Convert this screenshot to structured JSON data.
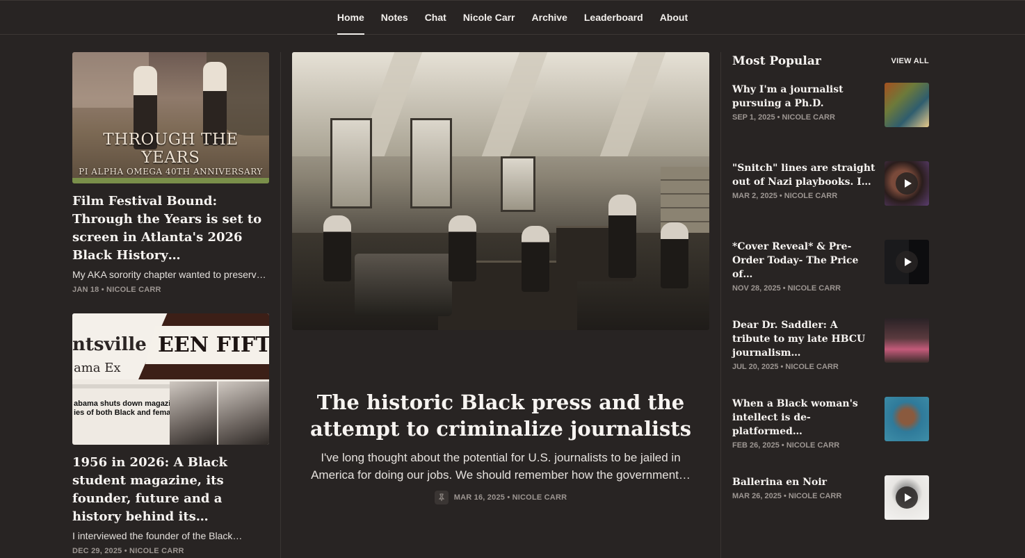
{
  "nav": {
    "items": [
      "Home",
      "Notes",
      "Chat",
      "Nicole Carr",
      "Archive",
      "Leaderboard",
      "About"
    ],
    "active": "Home"
  },
  "left": {
    "posts": [
      {
        "image_text_line1": "THROUGH THE YEARS",
        "image_text_line2": "PI ALPHA OMEGA 40TH ANNIVERSARY",
        "title": "Film Festival Bound: Through the Years is set to screen in Atlanta's 2026 Black History…",
        "subtitle": "My AKA sorority chapter wanted to preserv…",
        "meta": "JAN 18 • NICOLE CARR"
      },
      {
        "image_text_masthead": "EEN FIFTY-SIX",
        "image_text_tsville": "ntsville",
        "image_text_ama": "ama Ex",
        "image_text_headline": "abama shuts down magazines\nies of both Black and female",
        "title": "1956 in 2026: A Black student magazine, its founder, future and a history behind its…",
        "subtitle": "I interviewed the founder of the Black…",
        "meta": "DEC 29, 2025 • NICOLE CARR"
      }
    ]
  },
  "hero": {
    "title": "The historic Black press and the attempt to criminalize journalists",
    "subtitle": "I've long thought about the potential for U.S. journalists to be jailed in America for doing our jobs. We should remember how the government…",
    "meta": "MAR 16, 2025 • NICOLE CARR"
  },
  "popular": {
    "heading": "Most Popular",
    "view_all": "VIEW ALL",
    "items": [
      {
        "title": "Why I'm a journalist pursuing a Ph.D.",
        "meta": "SEP 1, 2025 • NICOLE CARR",
        "video": false
      },
      {
        "title": "\"Snitch\" lines are straight out of Nazi playbooks. I…",
        "meta": "MAR 2, 2025 • NICOLE CARR",
        "video": true
      },
      {
        "title": "*Cover Reveal* & Pre-Order Today- The Price of…",
        "meta": "NOV 28, 2025 • NICOLE CARR",
        "video": true
      },
      {
        "title": "Dear Dr. Saddler: A tribute to my late HBCU journalism…",
        "meta": "JUL 20, 2025 • NICOLE CARR",
        "video": false
      },
      {
        "title": "When a Black woman's intellect is de-platformed…",
        "meta": "FEB 26, 2025 • NICOLE CARR",
        "video": false
      },
      {
        "title": "Ballerina en Noir",
        "meta": "MAR 26, 2025 • NICOLE CARR",
        "video": true
      }
    ]
  },
  "colors": {
    "background": "#282423",
    "text": "#f2efec",
    "meta": "#9d9692",
    "divider": "#3a3533"
  }
}
